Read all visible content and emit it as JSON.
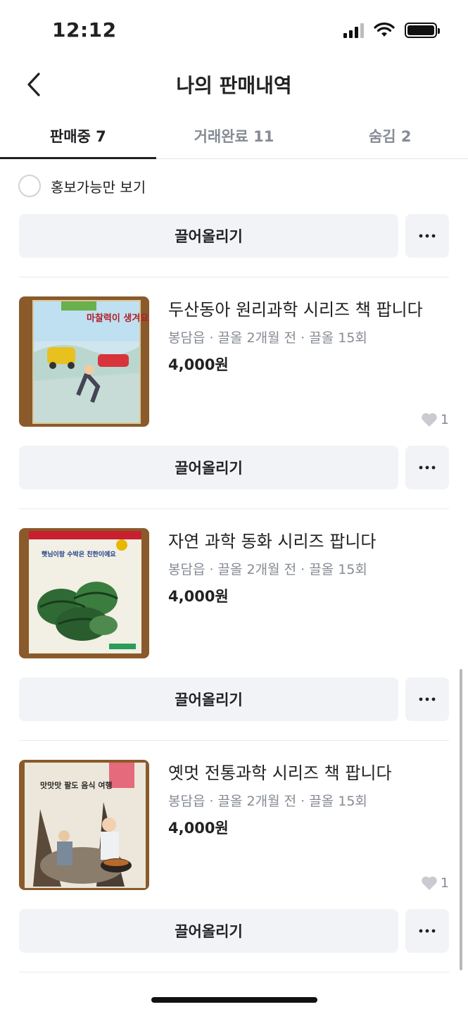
{
  "status_bar": {
    "time": "12:12",
    "icons": [
      "signal-icon",
      "wifi-icon",
      "battery-icon"
    ]
  },
  "header": {
    "title": "나의 판매내역",
    "back_icon": "chevron-left-icon"
  },
  "tabs": [
    {
      "label": "판매중 7",
      "active": true
    },
    {
      "label": "거래완료 11",
      "active": false
    },
    {
      "label": "숨김 2",
      "active": false
    }
  ],
  "filter": {
    "label": "홍보가능만 보기",
    "checked": false
  },
  "bump_label": "끌어올리기",
  "more_icon": "more-horizontal-icon",
  "listings": [
    {
      "title": "두산동아 원리과학 시리즈 책 팝니다",
      "meta": "봉담읍 · 끌올 2개월 전 · 끌올 15회",
      "price": "4,000원",
      "likes": "1",
      "cover_text": "마찰력이 생겨요"
    },
    {
      "title": "자연 과학 동화 시리즈 팝니다",
      "meta": "봉담읍 · 끌올 2개월 전 · 끌올 15회",
      "price": "4,000원",
      "likes": "",
      "cover_text": "햇님이랑 수박은 친한이에요"
    },
    {
      "title": "옛멋 전통과학 시리즈 책 팝니다",
      "meta": "봉담읍 · 끌올 2개월 전 · 끌올 15회",
      "price": "4,000원",
      "likes": "1",
      "cover_text": "맛맛맛 팔도 음식 여행"
    }
  ],
  "colors": {
    "text": "#212124",
    "muted": "#868b94",
    "button_bg": "#f2f3f6",
    "divider": "#e9e9ec"
  }
}
